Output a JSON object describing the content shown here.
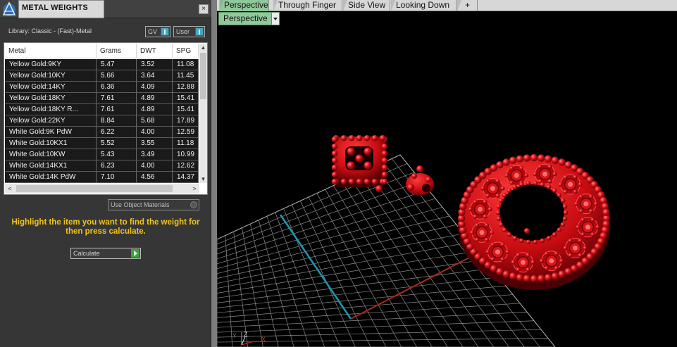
{
  "panel": {
    "title": "METAL WEIGHTS",
    "close_label": "×",
    "library_label": "Library: Classic - (Fast)-Metal",
    "gv_label": "GV",
    "user_label": "User",
    "use_object_label": "Use Object Materials",
    "hint": "Highlight the item you want to find the weight for then press calculate.",
    "calculate_label": "Calculate"
  },
  "table": {
    "headers": {
      "metal": "Metal",
      "grams": "Grams",
      "dwt": "DWT",
      "spg": "SPG"
    },
    "rows": [
      {
        "metal": "Yellow Gold:9KY",
        "grams": "5.47",
        "dwt": "3.52",
        "spg": "11.08"
      },
      {
        "metal": "Yellow Gold:10KY",
        "grams": "5.66",
        "dwt": "3.64",
        "spg": "11.45"
      },
      {
        "metal": "Yellow Gold:14KY",
        "grams": "6.36",
        "dwt": "4.09",
        "spg": "12.88"
      },
      {
        "metal": "Yellow Gold:18KY",
        "grams": "7.61",
        "dwt": "4.89",
        "spg": "15.41"
      },
      {
        "metal": "Yellow Gold:18KY R...",
        "grams": "7.61",
        "dwt": "4.89",
        "spg": "15.41"
      },
      {
        "metal": "Yellow Gold:22KY",
        "grams": "8.84",
        "dwt": "5.68",
        "spg": "17.89"
      },
      {
        "metal": "White Gold:9K PdW",
        "grams": "6.22",
        "dwt": "4.00",
        "spg": "12.59"
      },
      {
        "metal": "White Gold:10KX1",
        "grams": "5.52",
        "dwt": "3.55",
        "spg": "11.18"
      },
      {
        "metal": "White Gold:10KW",
        "grams": "5.43",
        "dwt": "3.49",
        "spg": "10.99"
      },
      {
        "metal": "White Gold:14KX1",
        "grams": "6.23",
        "dwt": "4.00",
        "spg": "12.62"
      },
      {
        "metal": "White Gold:14K PdW",
        "grams": "7.10",
        "dwt": "4.56",
        "spg": "14.37"
      }
    ]
  },
  "viewport": {
    "tabs": [
      "Perspective",
      "Through Finger",
      "Side View",
      "Looking Down",
      "+"
    ],
    "active_tab": "Perspective",
    "view_dropdown": "Perspective",
    "axis_labels": {
      "x": "X",
      "y": "Y",
      "z": "Z"
    }
  },
  "colors": {
    "panel_bg": "#363636",
    "hint_text": "#f2c418",
    "tab_active": "#8fc89a",
    "model_red": "#e0141a",
    "grid": "#8c8c8c",
    "axis_x": "#a62a1e",
    "axis_y": "#1d98b0"
  }
}
